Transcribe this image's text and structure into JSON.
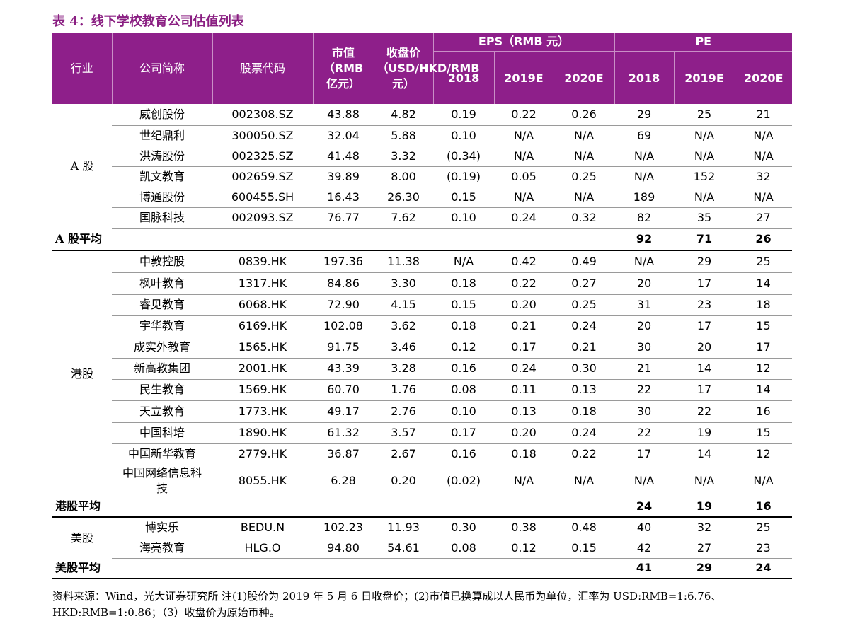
{
  "title": "表 4：线下学校教育公司估值列表",
  "header": {
    "industry": "行业",
    "company": "公司简称",
    "code": "股票代码",
    "mktcap": "市值（RMB 亿元）",
    "price": "收盘价（USD/HKD/RMB 元）",
    "eps": "EPS（RMB 元）",
    "pe": "PE",
    "years": [
      "2018",
      "2019E",
      "2020E",
      "2018",
      "2019E",
      "2020E"
    ]
  },
  "groups": [
    {
      "industry": "A 股",
      "rows": [
        {
          "name": "威创股份",
          "code": "002308.SZ",
          "cap": "43.88",
          "price": "4.82",
          "eps18": "0.19",
          "eps19": "0.22",
          "eps20": "0.26",
          "pe18": "29",
          "pe19": "25",
          "pe20": "21"
        },
        {
          "name": "世纪鼎利",
          "code": "300050.SZ",
          "cap": "32.04",
          "price": "5.88",
          "eps18": "0.10",
          "eps19": "N/A",
          "eps20": "N/A",
          "pe18": "69",
          "pe19": "N/A",
          "pe20": "N/A"
        },
        {
          "name": "洪涛股份",
          "code": "002325.SZ",
          "cap": "41.48",
          "price": "3.32",
          "eps18": "(0.34)",
          "eps19": "N/A",
          "eps20": "N/A",
          "pe18": "N/A",
          "pe19": "N/A",
          "pe20": "N/A"
        },
        {
          "name": "凯文教育",
          "code": "002659.SZ",
          "cap": "39.89",
          "price": "8.00",
          "eps18": "(0.19)",
          "eps19": "0.05",
          "eps20": "0.25",
          "pe18": "N/A",
          "pe19": "152",
          "pe20": "32"
        },
        {
          "name": "博通股份",
          "code": "600455.SH",
          "cap": "16.43",
          "price": "26.30",
          "eps18": "0.15",
          "eps19": "N/A",
          "eps20": "N/A",
          "pe18": "189",
          "pe19": "N/A",
          "pe20": "N/A"
        },
        {
          "name": "国脉科技",
          "code": "002093.SZ",
          "cap": "76.77",
          "price": "7.62",
          "eps18": "0.10",
          "eps19": "0.24",
          "eps20": "0.32",
          "pe18": "82",
          "pe19": "35",
          "pe20": "27"
        }
      ],
      "avg": {
        "label": "A 股平均",
        "pe18": "92",
        "pe19": "71",
        "pe20": "26"
      }
    },
    {
      "industry": "港股",
      "rows": [
        {
          "name": "中教控股",
          "code": "0839.HK",
          "cap": "197.36",
          "price": "11.38",
          "eps18": "N/A",
          "eps19": "0.42",
          "eps20": "0.49",
          "pe18": "N/A",
          "pe19": "29",
          "pe20": "25"
        },
        {
          "name": "枫叶教育",
          "code": "1317.HK",
          "cap": "84.86",
          "price": "3.30",
          "eps18": "0.18",
          "eps19": "0.22",
          "eps20": "0.27",
          "pe18": "20",
          "pe19": "17",
          "pe20": "14"
        },
        {
          "name": "睿见教育",
          "code": "6068.HK",
          "cap": "72.90",
          "price": "4.15",
          "eps18": "0.15",
          "eps19": "0.20",
          "eps20": "0.25",
          "pe18": "31",
          "pe19": "23",
          "pe20": "18"
        },
        {
          "name": "宇华教育",
          "code": "6169.HK",
          "cap": "102.08",
          "price": "3.62",
          "eps18": "0.18",
          "eps19": "0.21",
          "eps20": "0.24",
          "pe18": "20",
          "pe19": "17",
          "pe20": "15"
        },
        {
          "name": "成实外教育",
          "code": "1565.HK",
          "cap": "91.75",
          "price": "3.46",
          "eps18": "0.12",
          "eps19": "0.17",
          "eps20": "0.21",
          "pe18": "30",
          "pe19": "20",
          "pe20": "17"
        },
        {
          "name": "新高教集团",
          "code": "2001.HK",
          "cap": "43.39",
          "price": "3.28",
          "eps18": "0.16",
          "eps19": "0.24",
          "eps20": "0.30",
          "pe18": "21",
          "pe19": "14",
          "pe20": "12"
        },
        {
          "name": "民生教育",
          "code": "1569.HK",
          "cap": "60.70",
          "price": "1.76",
          "eps18": "0.08",
          "eps19": "0.11",
          "eps20": "0.13",
          "pe18": "22",
          "pe19": "17",
          "pe20": "14"
        },
        {
          "name": "天立教育",
          "code": "1773.HK",
          "cap": "49.17",
          "price": "2.76",
          "eps18": "0.10",
          "eps19": "0.13",
          "eps20": "0.18",
          "pe18": "30",
          "pe19": "22",
          "pe20": "16"
        },
        {
          "name": "中国科培",
          "code": "1890.HK",
          "cap": "61.32",
          "price": "3.57",
          "eps18": "0.17",
          "eps19": "0.20",
          "eps20": "0.24",
          "pe18": "22",
          "pe19": "19",
          "pe20": "15"
        },
        {
          "name": "中国新华教育",
          "code": "2779.HK",
          "cap": "36.87",
          "price": "2.67",
          "eps18": "0.16",
          "eps19": "0.18",
          "eps20": "0.22",
          "pe18": "17",
          "pe19": "14",
          "pe20": "12"
        },
        {
          "name": "中国网络信息科技",
          "code": "8055.HK",
          "cap": "6.28",
          "price": "0.20",
          "eps18": "(0.02)",
          "eps19": "N/A",
          "eps20": "N/A",
          "pe18": "N/A",
          "pe19": "N/A",
          "pe20": "N/A"
        }
      ],
      "avg": {
        "label": "港股平均",
        "pe18": "24",
        "pe19": "19",
        "pe20": "16"
      }
    },
    {
      "industry": "美股",
      "rows": [
        {
          "name": "博实乐",
          "code": "BEDU.N",
          "cap": "102.23",
          "price": "11.93",
          "eps18": "0.30",
          "eps19": "0.38",
          "eps20": "0.48",
          "pe18": "40",
          "pe19": "32",
          "pe20": "25"
        },
        {
          "name": "海亮教育",
          "code": "HLG.O",
          "cap": "94.80",
          "price": "54.61",
          "eps18": "0.08",
          "eps19": "0.12",
          "eps20": "0.15",
          "pe18": "42",
          "pe19": "27",
          "pe20": "23"
        }
      ],
      "avg": {
        "label": "美股平均",
        "pe18": "41",
        "pe19": "29",
        "pe20": "24"
      }
    }
  ],
  "note": "资料来源：Wind，光大证券研究所 注(1)股价为 2019 年 5 月 6 日收盘价；(2)市值已换算成以人民币为单位，汇率为 USD:RMB=1:6.76、HKD:RMB=1:0.86；（3）收盘价为原始币种。"
}
